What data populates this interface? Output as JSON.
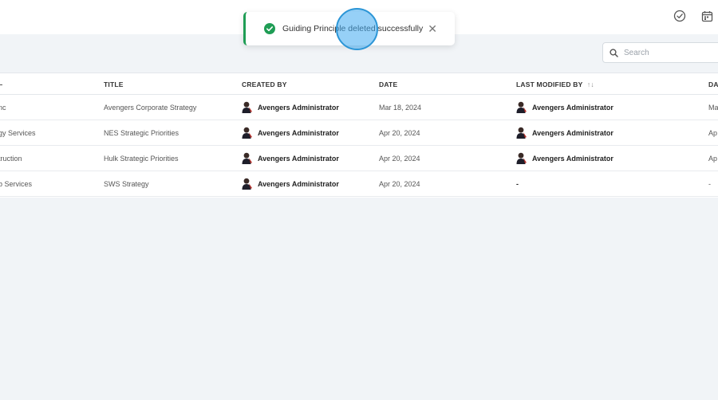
{
  "toast": {
    "message": "Guiding Principle deleted successfully",
    "close_glyph": "✕",
    "status_color": "#1f9d55"
  },
  "toolbar": {
    "icons": [
      "check-circle-icon",
      "calendar-icon"
    ]
  },
  "search": {
    "placeholder": "Search"
  },
  "table": {
    "headers": {
      "first": "",
      "title": "TITLE",
      "created_by": "CREATED BY",
      "date": "DATE",
      "last_modified_by": "LAST MODIFIED BY",
      "sort_glyph": "↑↓",
      "date2": "DA"
    },
    "rows": [
      {
        "first": "nc",
        "title": "Avengers Corporate Strategy",
        "created_by": "Avengers Administrator",
        "date": "Mar 18, 2024",
        "last_modified_by": "Avengers Administrator",
        "date2": "Ma"
      },
      {
        "first": "gy Services",
        "title": "NES Strategic Priorities",
        "created_by": "Avengers Administrator",
        "date": "Apr 20, 2024",
        "last_modified_by": "Avengers Administrator",
        "date2": "Ap"
      },
      {
        "first": "truction",
        "title": "Hulk Strategic Priorities",
        "created_by": "Avengers Administrator",
        "date": "Apr 20, 2024",
        "last_modified_by": "Avengers Administrator",
        "date2": "Ap"
      },
      {
        "first": "b Services",
        "title": "SWS Strategy",
        "created_by": "Avengers Administrator",
        "date": "Apr 20, 2024",
        "last_modified_by": "-",
        "date2": "-"
      }
    ]
  },
  "colors": {
    "background": "#f1f4f7",
    "success": "#1f9d55",
    "click_marker": "#2b95d6"
  }
}
